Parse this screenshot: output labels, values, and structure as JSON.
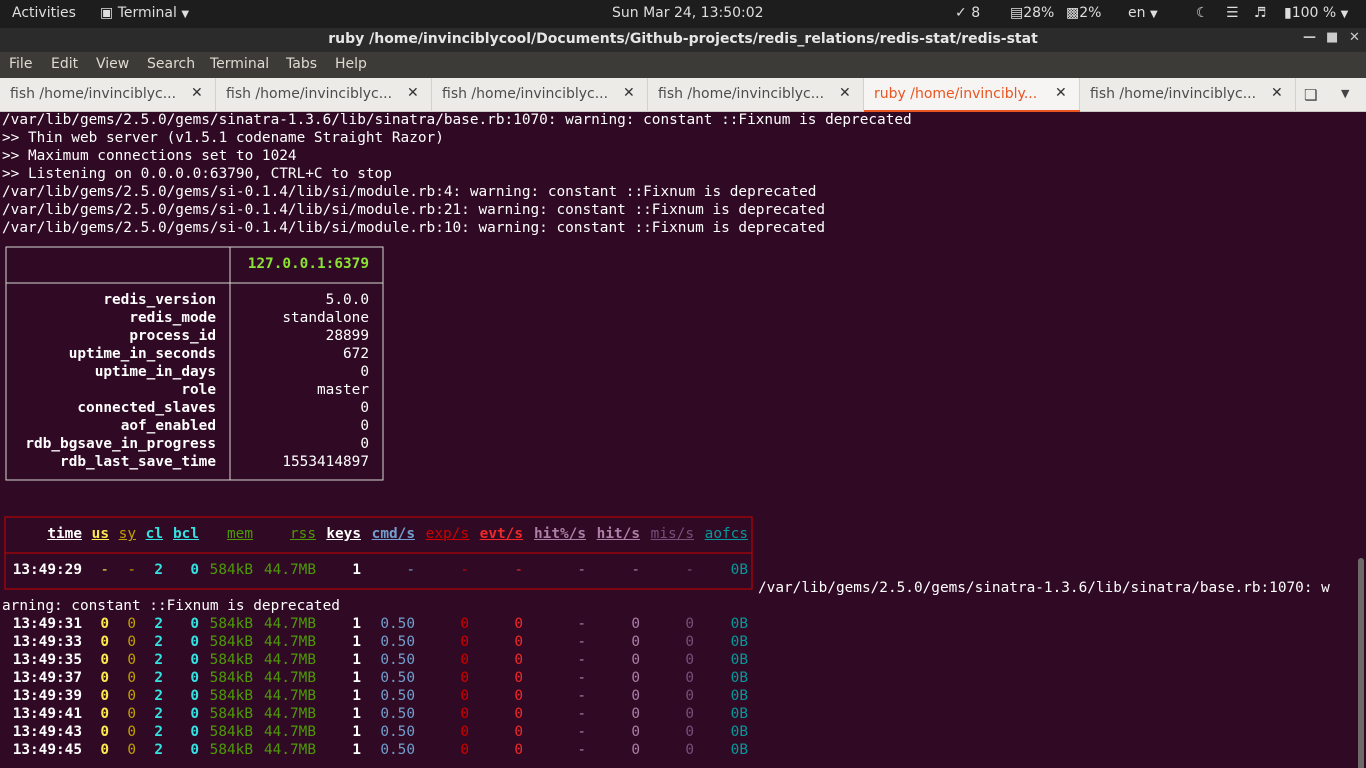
{
  "topbar": {
    "activities": "Activities",
    "app_menu": "Terminal",
    "clock": "Sun Mar 24, 13:50:02",
    "indicator_8": "8",
    "cpu": "28%",
    "mem": "2%",
    "lang": "en",
    "battery": "100 %"
  },
  "window": {
    "title": "ruby  /home/invinciblycool/Documents/Github-projects/redis_relations/redis-stat/redis-stat"
  },
  "menu": [
    "File",
    "Edit",
    "View",
    "Search",
    "Terminal",
    "Tabs",
    "Help"
  ],
  "tabs": [
    {
      "label": "fish  /home/invinciblyc...",
      "active": false
    },
    {
      "label": "fish  /home/invinciblyc...",
      "active": false
    },
    {
      "label": "fish  /home/invinciblyc...",
      "active": false
    },
    {
      "label": "fish  /home/invinciblyc...",
      "active": false
    },
    {
      "label": "ruby  /home/invincibly...",
      "active": true
    },
    {
      "label": "fish  /home/invinciblyc...",
      "active": false
    }
  ],
  "log_lines": [
    "/var/lib/gems/2.5.0/gems/sinatra-1.3.6/lib/sinatra/base.rb:1070: warning: constant ::Fixnum is deprecated",
    ">> Thin web server (v1.5.1 codename Straight Razor)",
    ">> Maximum connections set to 1024",
    ">> Listening on 0.0.0.0:63790, CTRL+C to stop",
    "/var/lib/gems/2.5.0/gems/si-0.1.4/lib/si/module.rb:4: warning: constant ::Fixnum is deprecated",
    "/var/lib/gems/2.5.0/gems/si-0.1.4/lib/si/module.rb:21: warning: constant ::Fixnum is deprecated",
    "/var/lib/gems/2.5.0/gems/si-0.1.4/lib/si/module.rb:10: warning: constant ::Fixnum is deprecated"
  ],
  "info": {
    "host": "127.0.0.1:6379",
    "rows": [
      {
        "k": "redis_version",
        "v": "5.0.0"
      },
      {
        "k": "redis_mode",
        "v": "standalone"
      },
      {
        "k": "process_id",
        "v": "28899"
      },
      {
        "k": "uptime_in_seconds",
        "v": "672"
      },
      {
        "k": "uptime_in_days",
        "v": "0"
      },
      {
        "k": "role",
        "v": "master"
      },
      {
        "k": "connected_slaves",
        "v": "0"
      },
      {
        "k": "aof_enabled",
        "v": "0"
      },
      {
        "k": "rdb_bgsave_in_progress",
        "v": "0"
      },
      {
        "k": "rdb_last_save_time",
        "v": "1553414897"
      }
    ]
  },
  "stats": {
    "headers": [
      "time",
      "us",
      "sy",
      "cl",
      "bcl",
      "mem",
      "rss",
      "keys",
      "cmd/s",
      "exp/s",
      "evt/s",
      "hit%/s",
      "hit/s",
      "mis/s",
      "aofcs"
    ],
    "first": [
      "13:49:29",
      "-",
      "-",
      "2",
      "0",
      "584kB",
      "44.7MB",
      "1",
      "-",
      "-",
      "-",
      "-",
      "-",
      "-",
      "0B"
    ],
    "warn_tail": "/var/lib/gems/2.5.0/gems/sinatra-1.3.6/lib/sinatra/base.rb:1070: w",
    "warn_head": "arning: constant ::Fixnum is deprecated",
    "rows": [
      [
        "13:49:31",
        "0",
        "0",
        "2",
        "0",
        "584kB",
        "44.7MB",
        "1",
        "0.50",
        "0",
        "0",
        "-",
        "0",
        "0",
        "0B"
      ],
      [
        "13:49:33",
        "0",
        "0",
        "2",
        "0",
        "584kB",
        "44.7MB",
        "1",
        "0.50",
        "0",
        "0",
        "-",
        "0",
        "0",
        "0B"
      ],
      [
        "13:49:35",
        "0",
        "0",
        "2",
        "0",
        "584kB",
        "44.7MB",
        "1",
        "0.50",
        "0",
        "0",
        "-",
        "0",
        "0",
        "0B"
      ],
      [
        "13:49:37",
        "0",
        "0",
        "2",
        "0",
        "584kB",
        "44.7MB",
        "1",
        "0.50",
        "0",
        "0",
        "-",
        "0",
        "0",
        "0B"
      ],
      [
        "13:49:39",
        "0",
        "0",
        "2",
        "0",
        "584kB",
        "44.7MB",
        "1",
        "0.50",
        "0",
        "0",
        "-",
        "0",
        "0",
        "0B"
      ],
      [
        "13:49:41",
        "0",
        "0",
        "2",
        "0",
        "584kB",
        "44.7MB",
        "1",
        "0.50",
        "0",
        "0",
        "-",
        "0",
        "0",
        "0B"
      ],
      [
        "13:49:43",
        "0",
        "0",
        "2",
        "0",
        "584kB",
        "44.7MB",
        "1",
        "0.50",
        "0",
        "0",
        "-",
        "0",
        "0",
        "0B"
      ],
      [
        "13:49:45",
        "0",
        "0",
        "2",
        "0",
        "584kB",
        "44.7MB",
        "1",
        "0.50",
        "0",
        "0",
        "-",
        "0",
        "0",
        "0B"
      ]
    ]
  },
  "colors": {
    "bg": "#300a24",
    "text": "#ffffff",
    "host": "#8ae234",
    "border_info": "#d3d7cf",
    "border_stats": "#cc0000",
    "accent": "#e95420"
  }
}
